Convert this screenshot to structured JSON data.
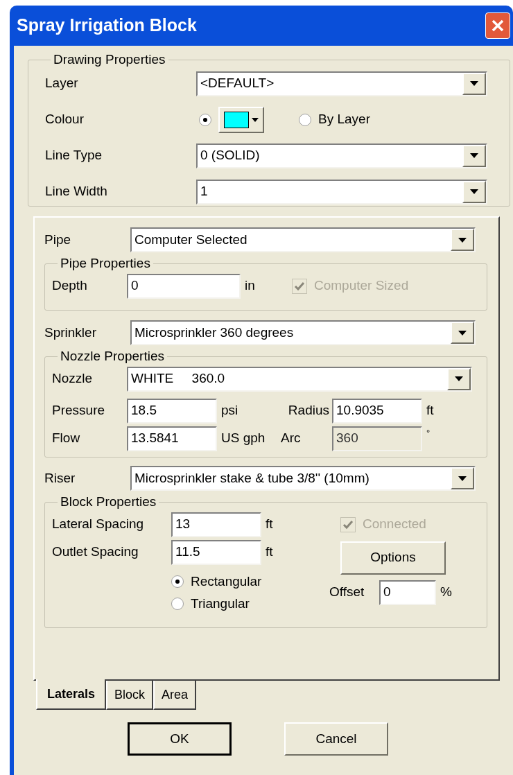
{
  "window": {
    "title": "Spray Irrigation Block"
  },
  "drawing_properties": {
    "title": "Drawing Properties",
    "layer": {
      "label": "Layer",
      "value": "<DEFAULT>"
    },
    "colour": {
      "label": "Colour",
      "options": [
        {
          "kind": "swatch",
          "selected": true,
          "color": "#00ffff"
        },
        {
          "kind": "text",
          "label": "By Layer",
          "selected": false
        }
      ]
    },
    "line_type": {
      "label": "Line Type",
      "value": "0 (SOLID)"
    },
    "line_width": {
      "label": "Line Width",
      "value": "1"
    }
  },
  "tab_panel": {
    "pipe": {
      "label": "Pipe",
      "value": "Computer Selected"
    },
    "pipe_properties": {
      "title": "Pipe Properties",
      "depth": {
        "label": "Depth",
        "value": "0",
        "unit": "in"
      },
      "computer_sized": {
        "label": "Computer Sized",
        "checked": true,
        "disabled": true
      }
    },
    "sprinkler": {
      "label": "Sprinkler",
      "value": "Microsprinkler 360 degrees"
    },
    "nozzle_properties": {
      "title": "Nozzle Properties",
      "nozzle": {
        "label": "Nozzle",
        "value": "WHITE     360.0"
      },
      "pressure": {
        "label": "Pressure",
        "value": "18.5",
        "unit": "psi",
        "disabled": false
      },
      "radius": {
        "label": "Radius",
        "value": "10.9035",
        "unit": "ft",
        "disabled": false
      },
      "flow": {
        "label": "Flow",
        "value": "13.5841",
        "unit": "US gph",
        "disabled": false
      },
      "arc": {
        "label": "Arc",
        "value": "360",
        "unit": "°",
        "disabled": true
      }
    },
    "riser": {
      "label": "Riser",
      "value": "Microsprinkler stake & tube 3/8'' (10mm)"
    },
    "block_properties": {
      "title": "Block Properties",
      "lateral_spacing": {
        "label": "Lateral Spacing",
        "value": "13",
        "unit": "ft"
      },
      "outlet_spacing": {
        "label": "Outlet Spacing",
        "value": "11.5",
        "unit": "ft"
      },
      "layout": [
        {
          "label": "Rectangular",
          "selected": true
        },
        {
          "label": "Triangular",
          "selected": false
        }
      ],
      "connected": {
        "label": "Connected",
        "checked": true,
        "disabled": true
      },
      "options_button": "Options",
      "offset": {
        "label": "Offset",
        "value": "0",
        "unit": "%"
      }
    }
  },
  "tabs": [
    {
      "label": "Laterals",
      "selected": true
    },
    {
      "label": "Block",
      "selected": false
    },
    {
      "label": "Area",
      "selected": false
    }
  ],
  "buttons": [
    {
      "label": "OK",
      "default": true
    },
    {
      "label": "Cancel",
      "default": false
    }
  ]
}
